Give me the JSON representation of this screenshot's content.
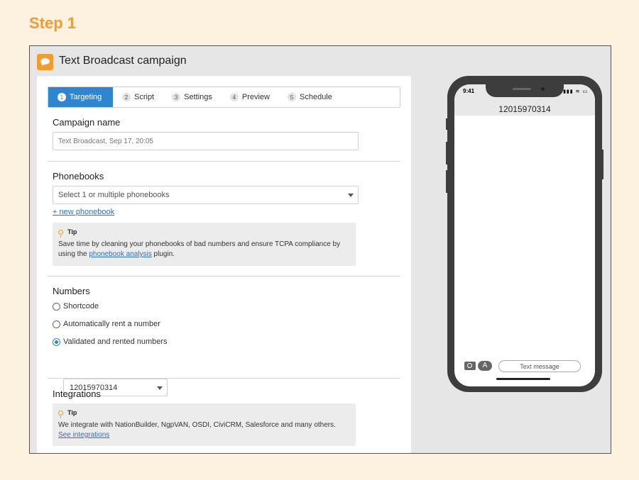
{
  "step_title": "Step 1",
  "window": {
    "title": "Text Broadcast campaign"
  },
  "tabs": [
    {
      "num": "1",
      "label": "Targeting"
    },
    {
      "num": "2",
      "label": "Script"
    },
    {
      "num": "3",
      "label": "Settings"
    },
    {
      "num": "4",
      "label": "Preview"
    },
    {
      "num": "5",
      "label": "Schedule"
    }
  ],
  "campaign": {
    "label": "Campaign name",
    "placeholder": "Text Broadcast, Sep 17, 20:05"
  },
  "phonebooks": {
    "label": "Phonebooks",
    "select_placeholder": "Select 1 or multiple phonebooks",
    "new_link": "+ new phonebook",
    "tip": {
      "title": "Tip",
      "text_before": "Save time by cleaning your phonebooks of bad numbers and ensure TCPA compliance by using the ",
      "link": "phonebook analysis",
      "text_after": " plugin."
    }
  },
  "numbers": {
    "label": "Numbers",
    "options": [
      "Shortcode",
      "Automatically rent a number",
      "Validated and rented numbers"
    ],
    "selected_index": 2,
    "selected_number": "12015970314"
  },
  "integrations": {
    "label": "Integrations",
    "tip": {
      "title": "Tip",
      "text_before": "We integrate with NationBuilder, NgpVAN, OSDI, CiviCRM, Salesforce and many others. ",
      "link": "See integrations"
    }
  },
  "phone": {
    "time": "9:41",
    "status_icons": "▮▮▮ ≋ ▭",
    "contact": "12015970314",
    "app_icon_glyph": "A",
    "text_message_placeholder": "Text message"
  },
  "colors": {
    "accent": "#2e86d1",
    "brand": "#f39c2b",
    "background": "#fdf1e0"
  }
}
